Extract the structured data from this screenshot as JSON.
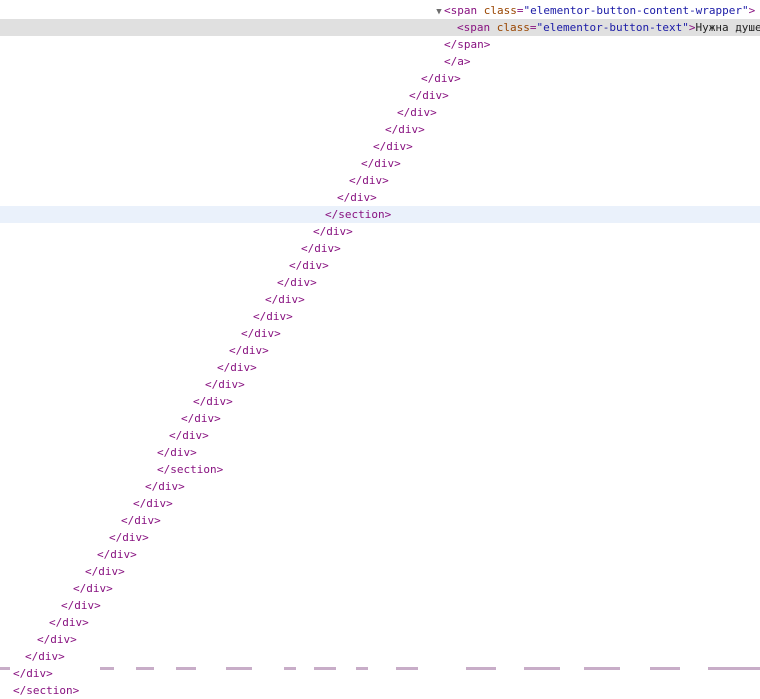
{
  "tree": {
    "open_span": {
      "expand_glyph": "▼",
      "tag_open": "<span",
      "attr_name": "class",
      "attr_eq": "=",
      "attr_value": "\"elementor-button-content-wrapper\"",
      "tag_close": ">"
    },
    "text_span": {
      "tag_open": "<span",
      "attr_name": "class",
      "attr_eq": "=",
      "attr_value": "\"elementor-button-text\"",
      "tag_close": ">",
      "text": "Нужна душе"
    },
    "closing_tags": [
      "</span>",
      "</a>",
      "</div>",
      "</div>",
      "</div>",
      "</div>",
      "</div>",
      "</div>",
      "</div>",
      "</div>",
      "</section>",
      "</div>",
      "</div>",
      "</div>",
      "</div>",
      "</div>",
      "</div>",
      "</div>",
      "</div>",
      "</div>",
      "</div>",
      "</div>",
      "</div>",
      "</div>",
      "</div>",
      "</section>",
      "</div>",
      "</div>",
      "</div>",
      "</div>",
      "</div>",
      "</div>",
      "</div>",
      "</div>",
      "</div>",
      "</div>",
      "</div>",
      "</div>",
      "</section>"
    ]
  },
  "colors": {
    "tag": "#881280",
    "attr_name": "#994500",
    "attr_value": "#1a1aa6",
    "selected_row": "#e0e0e0",
    "hover_row": "#eaf1fb"
  }
}
